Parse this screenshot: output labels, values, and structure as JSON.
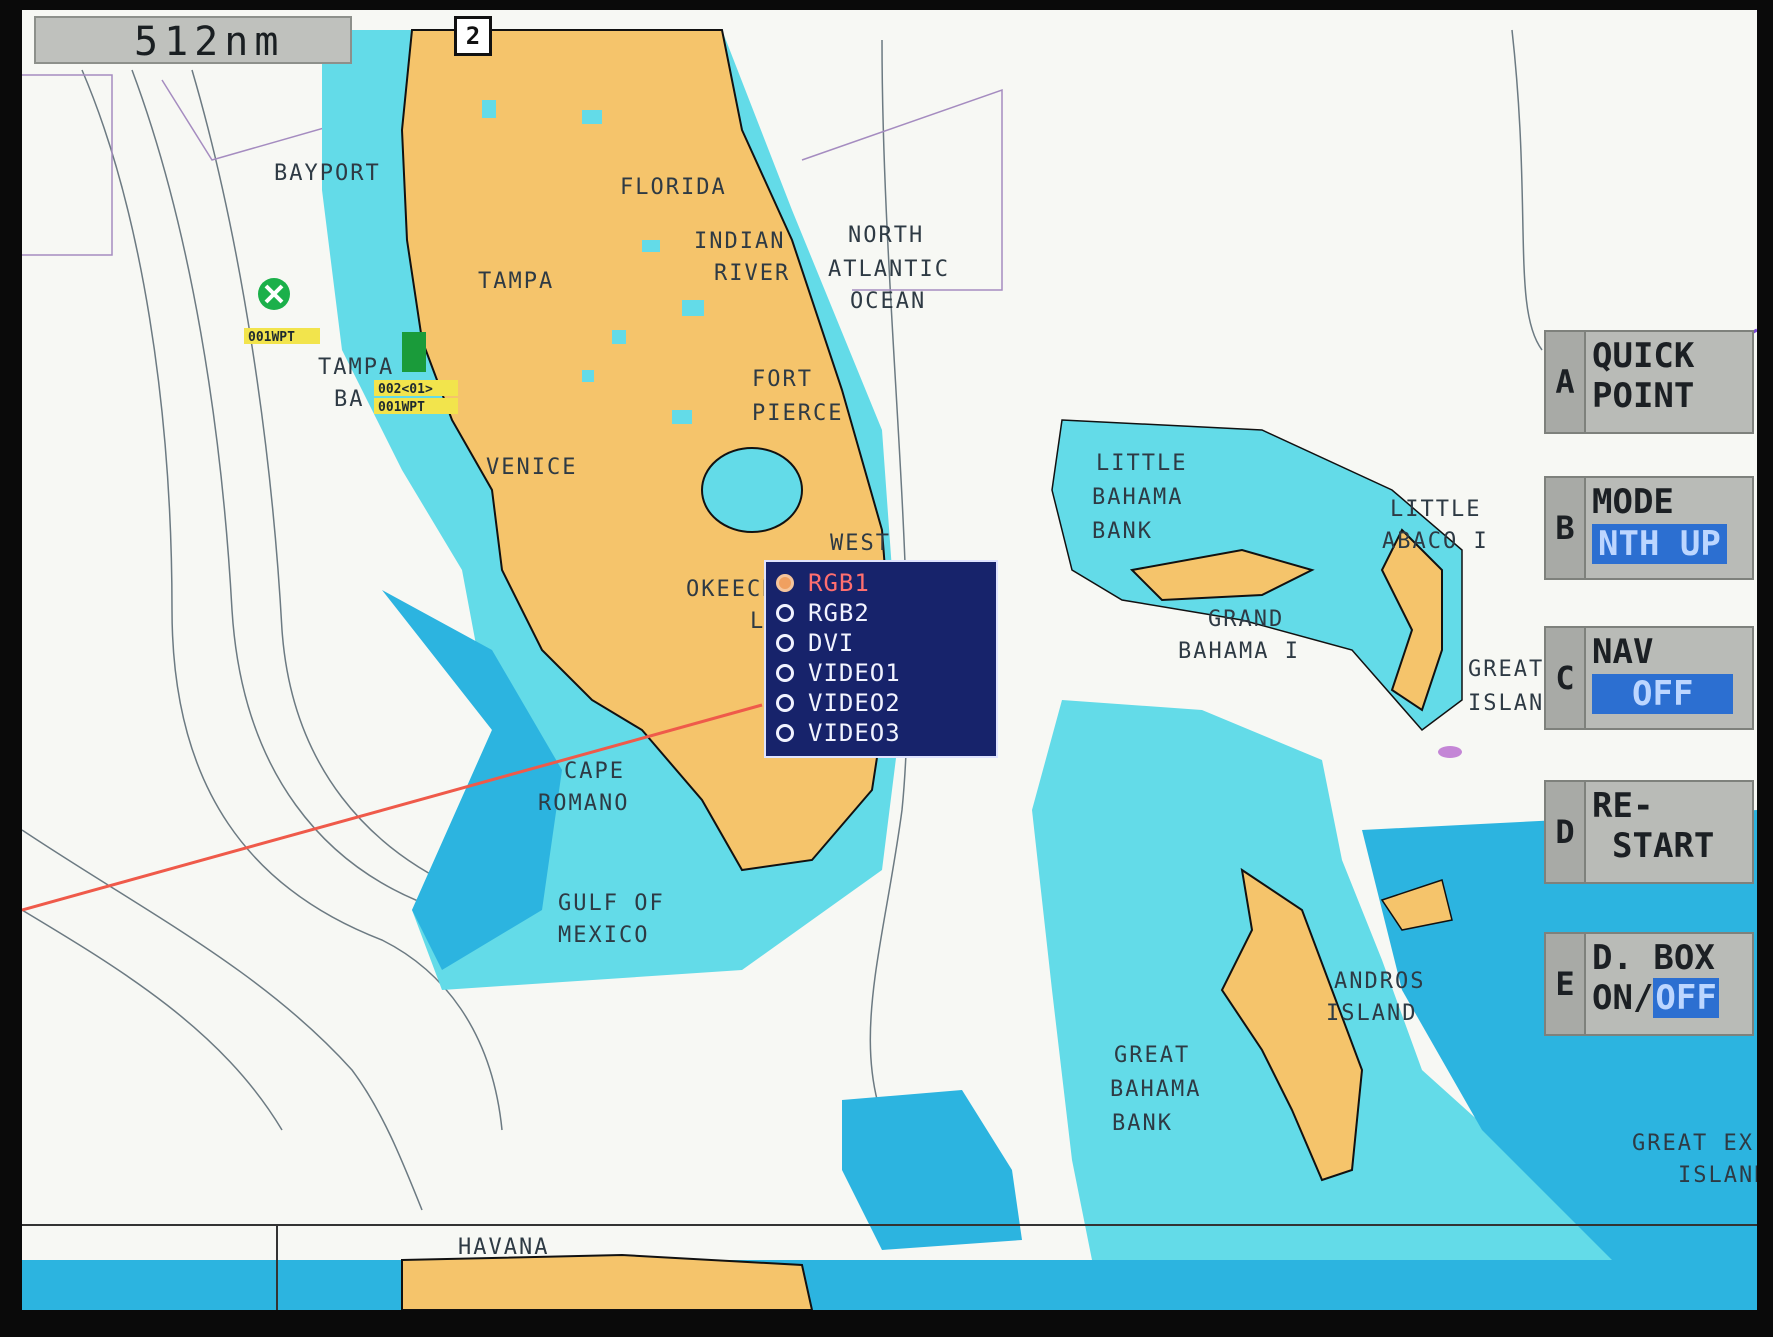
{
  "range": "512nm",
  "north_indicator": "2",
  "chart_labels": {
    "bayport": "BAYPORT",
    "florida": "FLORIDA",
    "indian": "INDIAN",
    "river": "RIVER",
    "north": "NORTH",
    "atlantic": "ATLANTIC",
    "ocean": "OCEAN",
    "tampa": "TAMPA",
    "tampa_bay_1": "TAMPA",
    "tampa_bay_2": "BA",
    "fort": "FORT",
    "pierce": "PIERCE",
    "venice": "VENICE",
    "west": "WEST",
    "okeech": "OKEECH",
    "la": "LA",
    "cape": "CAPE",
    "romano": "ROMANO",
    "gulf_of": "GULF OF",
    "mexico": "MEXICO",
    "little_bahama_1": "LITTLE",
    "little_bahama_2": "BAHAMA",
    "little_bahama_3": "BANK",
    "little_abaco_1": "LITTLE",
    "little_abaco_2": "ABACO I",
    "grand_1": "GRAND",
    "grand_2": "BAHAMA I",
    "great_a_1": "GREAT A",
    "great_a_2": "ISLAND",
    "andros_1": "ANDROS",
    "andros_2": "ISLAND",
    "great_bahama_1": "GREAT",
    "great_bahama_2": "BAHAMA",
    "great_bahama_3": "BANK",
    "great_ex_1": "GREAT EX",
    "great_ex_2": "ISLAND",
    "havana": "HAVANA",
    "waypoint_1": "001WPT",
    "waypoint_2": "002<01>",
    "waypoint_3": "001WPT"
  },
  "source_menu": {
    "items": [
      {
        "label": "RGB1",
        "selected": true
      },
      {
        "label": "RGB2",
        "selected": false
      },
      {
        "label": "DVI",
        "selected": false
      },
      {
        "label": "VIDEO1",
        "selected": false
      },
      {
        "label": "VIDEO2",
        "selected": false
      },
      {
        "label": "VIDEO3",
        "selected": false
      }
    ]
  },
  "softkeys": {
    "a": {
      "letter": "A",
      "line1": "QUICK",
      "line2": "POINT"
    },
    "b": {
      "letter": "B",
      "line1": "MODE",
      "value": "NTH UP"
    },
    "c": {
      "letter": "C",
      "line1": "NAV",
      "value": "OFF"
    },
    "d": {
      "letter": "D",
      "line1": "RE-",
      "line2": "START"
    },
    "e": {
      "letter": "E",
      "line1": "D. BOX",
      "on": "ON/",
      "off": "OFF"
    }
  },
  "colors": {
    "land": "#f5c46b",
    "shallow": "#63dbe8",
    "deep": "#2cb4e0",
    "water": "#f7f8f4",
    "menu_bg": "#17236b",
    "value_bg": "#2c6fd1",
    "route": "#ef5a4a"
  }
}
